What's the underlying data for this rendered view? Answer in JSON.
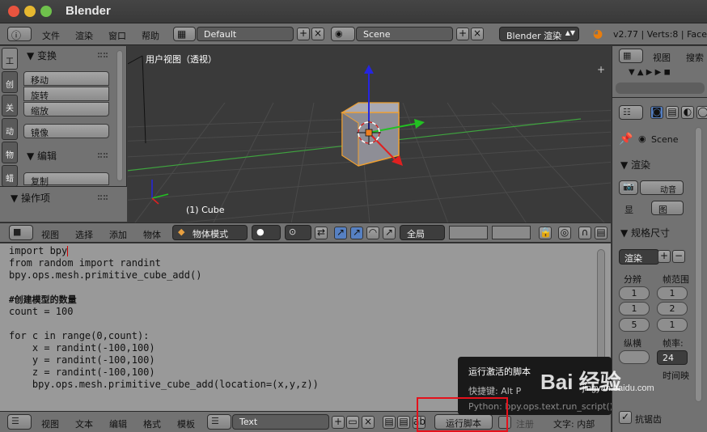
{
  "window": {
    "title": "Blender"
  },
  "info_header": {
    "menus": [
      "文件",
      "渲染",
      "窗口",
      "帮助"
    ],
    "screen_layout": "Default",
    "scene": "Scene",
    "render_engine": "Blender 渲染",
    "stats": "v2.77 | Verts:8 | Faces"
  },
  "tool_shelf": {
    "tabs": [
      "工",
      "创",
      "关",
      "动",
      "物",
      "蜡"
    ],
    "transform_title": "▼ 变换",
    "transform_buttons": [
      "移动",
      "旋转",
      "缩放"
    ],
    "mirror": "镜像",
    "edit_title": "▼ 编辑",
    "duplicate": "复制",
    "operator_title": "▼ 操作项"
  },
  "viewport": {
    "view_label": "用户视图（透视）",
    "object_label": "(1) Cube"
  },
  "viewport_header": {
    "menus": [
      "视图",
      "选择",
      "添加",
      "物体"
    ],
    "mode": "物体模式",
    "pivot": "全局"
  },
  "text_editor": {
    "lines": [
      "import bpy",
      "from random import randint",
      "bpy.ops.mesh.primitive_cube_add()",
      "",
      "#创建模型的数量",
      "count = 100",
      "",
      "for c in range(0,count):",
      "    x = randint(-100,100)",
      "    y = randint(-100,100)",
      "    z = randint(-100,100)",
      "    bpy.ops.mesh.primitive_cube_add(location=(x,y,z))"
    ]
  },
  "text_header": {
    "menus": [
      "视图",
      "文本",
      "编辑",
      "格式",
      "模板"
    ],
    "text_name": "Text",
    "run_script": "运行脚本",
    "register": "注册",
    "text_source": "文字: 内部"
  },
  "tooltip": {
    "title": "运行激活的脚本",
    "shortcut": "快捷键: Alt P",
    "python": "Python: bpy.ops.text.run_script()"
  },
  "properties": {
    "top_menus": [
      "视图",
      "搜索"
    ],
    "scene": "Scene",
    "render_title": "▼ 渲染",
    "render_btn1": "动",
    "render_btn2": "音",
    "display_label": "显",
    "display_value": "图",
    "dimensions_title": "▼ 规格尺寸",
    "preset": "渲染",
    "resolution_label": "分辨",
    "frame_range_label": "帧范围",
    "res_x": "1",
    "res_y": "1",
    "res_pct": "5",
    "frame_start": "1",
    "frame_end": "2",
    "frame_step": "1",
    "aspect_label": "纵横",
    "framerate_label": "帧率:",
    "framerate_value": "24",
    "time_remap_label": "时间映",
    "aa_label": "抗锯齿"
  },
  "watermark": {
    "text": "Bai 经验",
    "sub": "jingyan.baidu.com"
  }
}
